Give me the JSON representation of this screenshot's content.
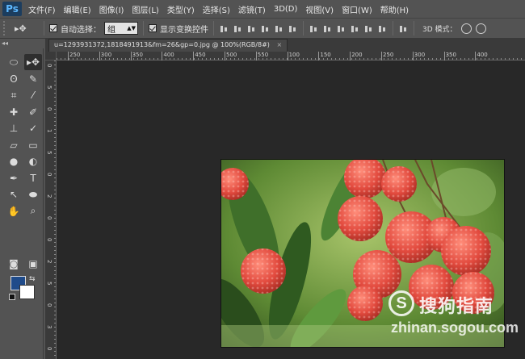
{
  "app": {
    "logo": "Ps"
  },
  "menu": [
    "文件(F)",
    "编辑(E)",
    "图像(I)",
    "图层(L)",
    "类型(Y)",
    "选择(S)",
    "滤镜(T)",
    "3D(D)",
    "视图(V)",
    "窗口(W)",
    "帮助(H)"
  ],
  "options": {
    "tool_glyph": "▸✥",
    "auto_select_label": "自动选择：",
    "auto_select_value": "组",
    "auto_select_checked": true,
    "show_transform_label": "显示变换控件",
    "show_transform_checked": true,
    "mode_3d_label": "3D 模式："
  },
  "document": {
    "tab_title": "u=1293931372,1818491913&fm=26&gp=0.jpg @ 100%(RGB/8#)",
    "close_glyph": "×"
  },
  "ruler": {
    "h_labels": [
      "250",
      "300",
      "350",
      "400",
      "450",
      "500",
      "550",
      "100",
      "150",
      "200",
      "250",
      "300",
      "350",
      "400"
    ],
    "v_labels": [
      "0",
      "5",
      "0",
      "1",
      "5",
      "0",
      "2",
      "0",
      "0",
      "2",
      "5",
      "0",
      "3",
      "0"
    ]
  },
  "tools": [
    {
      "name": "marquee-tool",
      "glyph": "⬭"
    },
    {
      "name": "move-tool",
      "glyph": "▸✥"
    },
    {
      "name": "lasso-tool",
      "glyph": "ʘ"
    },
    {
      "name": "quick-select-tool",
      "glyph": "✎"
    },
    {
      "name": "crop-tool",
      "glyph": "⌗"
    },
    {
      "name": "eyedropper-tool",
      "glyph": "⁄"
    },
    {
      "name": "healing-tool",
      "glyph": "✚"
    },
    {
      "name": "brush-tool",
      "glyph": "✐"
    },
    {
      "name": "stamp-tool",
      "glyph": "⊥"
    },
    {
      "name": "history-brush-tool",
      "glyph": "✓"
    },
    {
      "name": "eraser-tool",
      "glyph": "▱"
    },
    {
      "name": "gradient-tool",
      "glyph": "▭"
    },
    {
      "name": "blur-tool",
      "glyph": "●"
    },
    {
      "name": "dodge-tool",
      "glyph": "◐"
    },
    {
      "name": "pen-tool",
      "glyph": "✒"
    },
    {
      "name": "type-tool",
      "glyph": "T"
    },
    {
      "name": "path-select-tool",
      "glyph": "↖"
    },
    {
      "name": "shape-tool",
      "glyph": "⬬"
    },
    {
      "name": "hand-tool",
      "glyph": "✋"
    },
    {
      "name": "zoom-tool",
      "glyph": "⌕"
    },
    {
      "name": "quick-mask-tool",
      "glyph": "◙"
    },
    {
      "name": "screen-mode-tool",
      "glyph": "▣"
    }
  ],
  "colors": {
    "foreground": "#1f4b8a",
    "background": "#ffffff"
  },
  "watermark": {
    "brand_cn": "搜狗指南",
    "url": "zhinan.sogou.com",
    "logo_glyph": "S"
  }
}
